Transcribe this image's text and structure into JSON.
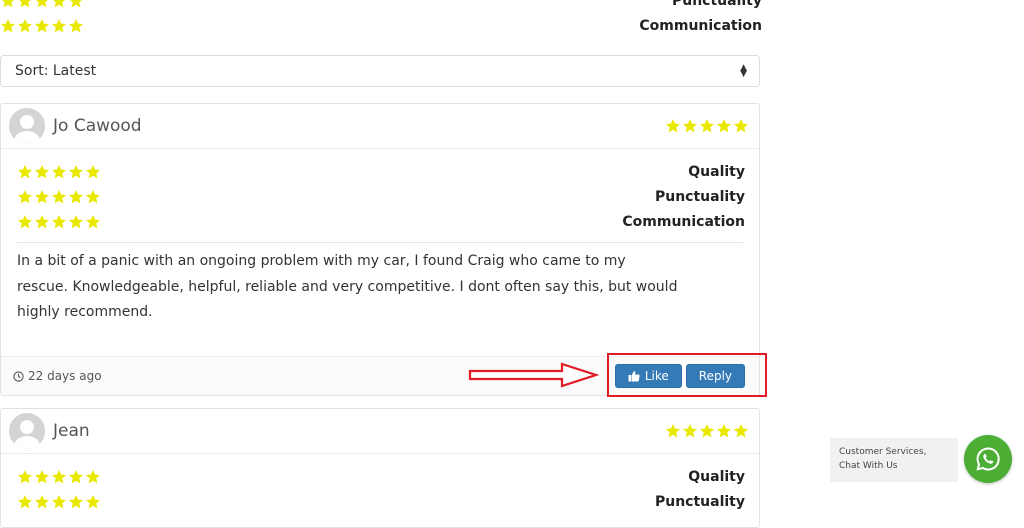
{
  "colors": {
    "star": "#e8e800",
    "primary": "#337ab7",
    "annotation": "#e01b24",
    "whatsapp": "#4cae35"
  },
  "top_summary": {
    "rows": [
      {
        "label": "Punctuality",
        "stars": 5
      },
      {
        "label": "Communication",
        "stars": 5
      }
    ]
  },
  "sort": {
    "label": "Sort: Latest"
  },
  "reviews": [
    {
      "author": "Jo Cawood",
      "overall_stars": 5,
      "criteria": [
        {
          "label": "Quality",
          "stars": 5
        },
        {
          "label": "Punctuality",
          "stars": 5
        },
        {
          "label": "Communication",
          "stars": 5
        }
      ],
      "text": "In a bit of a panic with an ongoing problem with my car, I found Craig who came to my rescue. Knowledgeable, helpful, reliable and very competitive. I dont often say this, but would highly recommend.",
      "time": "22 days ago",
      "like_label": "Like",
      "reply_label": "Reply"
    },
    {
      "author": "Jean",
      "overall_stars": 5,
      "criteria": [
        {
          "label": "Quality",
          "stars": 5
        },
        {
          "label": "Punctuality",
          "stars": 5
        }
      ]
    }
  ],
  "chat": {
    "label": "Customer Services, Chat With Us",
    "icon": "whatsapp-icon"
  }
}
